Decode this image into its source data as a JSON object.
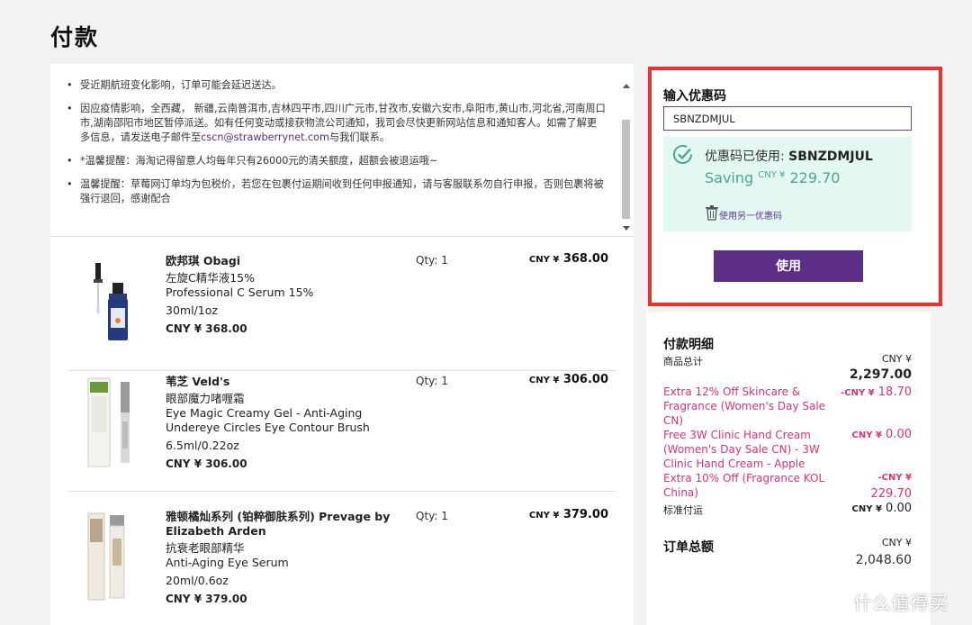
{
  "page": {
    "title": "付款"
  },
  "notices": [
    "受近期航班变化影响，订单可能会延迟送达。",
    "因应疫情影响，全西藏， 新疆,云南普洱市,吉林四平市,四川广元市,甘孜市,安徽六安市,阜阳市,黄山市,河北省,河南周口市,湖南邵阳市地区暂停派送。如有任何变动或接获物流公司通知，我司会尽快更新网站信息和通知客人。如需了解更多信息，请发送电子邮件至",
    "*温馨提醒：海淘记得留意人均每年只有26000元的清关额度，超额会被退运哦~",
    "温馨提醒：草莓网订单均为包税价，若您在包裹付运期间收到任何申报通知，请与客服联系勿自行申报，否则包裹将被强行退回，感谢配合"
  ],
  "notice_email": "cscn@strawberrynet.com",
  "notice_email_suffix": "与我们联系。",
  "products": [
    {
      "brand": "欧邦琪 Obagi",
      "name_cn": "左旋C精华液15%",
      "name_en": "Professional C Serum 15%",
      "size": "30ml/1oz",
      "price": "CNY ¥ 368.00",
      "qty": "Qty: 1",
      "line_cny": "CNY ¥",
      "line_amount": "368.00"
    },
    {
      "brand": "苇芝 Veld's",
      "name_cn": "眼部魔力啫喱霜",
      "name_en": "Eye Magic Creamy Gel - Anti-Aging Undereye Circles Eye Contour Brush",
      "size": "6.5ml/0.22oz",
      "price": "CNY ¥ 306.00",
      "qty": "Qty: 1",
      "line_cny": "CNY ¥",
      "line_amount": "306.00"
    },
    {
      "brand": "雅顿橘灿系列 (铂粹御肤系列) Prevage by Elizabeth Arden",
      "name_cn": "抗衰老眼部精华",
      "name_en": "Anti-Aging Eye Serum",
      "size": "20ml/0.6oz",
      "price": "CNY ¥ 379.00",
      "qty": "Qty: 1",
      "line_cny": "CNY ¥",
      "line_amount": "379.00"
    }
  ],
  "coupon": {
    "title": "输入优惠码",
    "input_value": "SBNZDMJUL",
    "applied_prefix": "优惠码已使用: ",
    "applied_code": "SBNZDMJUL",
    "saving_label": "Saving",
    "saving_cny": "CNY ¥",
    "saving_amount": "229.70",
    "use_other": "使用另一优惠码",
    "apply_button": "使用"
  },
  "summary": {
    "title": "付款明细",
    "subtotal_label": "商品总计",
    "subtotal_cny": "CNY ¥",
    "subtotal_value": "2,297.00",
    "discounts": [
      {
        "label": "Extra 12% Off Skincare & Fragrance (Women's Day Sale CN)",
        "cny": "-CNY ¥",
        "value": "18.70"
      },
      {
        "label": "Free 3W Clinic Hand Cream (Women's Day Sale CN) - 3W Clinic Hand Cream - Apple",
        "cny": "CNY ¥",
        "value": "0.00"
      },
      {
        "label": "Extra 10% Off (Fragrance KOL China)",
        "cny": "-CNY ¥",
        "value": "229.70"
      }
    ],
    "shipping_label": "标准付运",
    "shipping_cny": "CNY ¥",
    "shipping_value": "0.00",
    "total_label": "订单总额",
    "total_cny": "CNY ¥",
    "total_value": "2,048.60"
  },
  "watermark": {
    "text": "什么值得买",
    "icon": "value-logo-icon"
  },
  "colors": {
    "accent_purple": "#5c2e86",
    "discount_pink": "#e0317a",
    "highlight_red": "#e63232",
    "saving_green": "#4aa58f"
  }
}
